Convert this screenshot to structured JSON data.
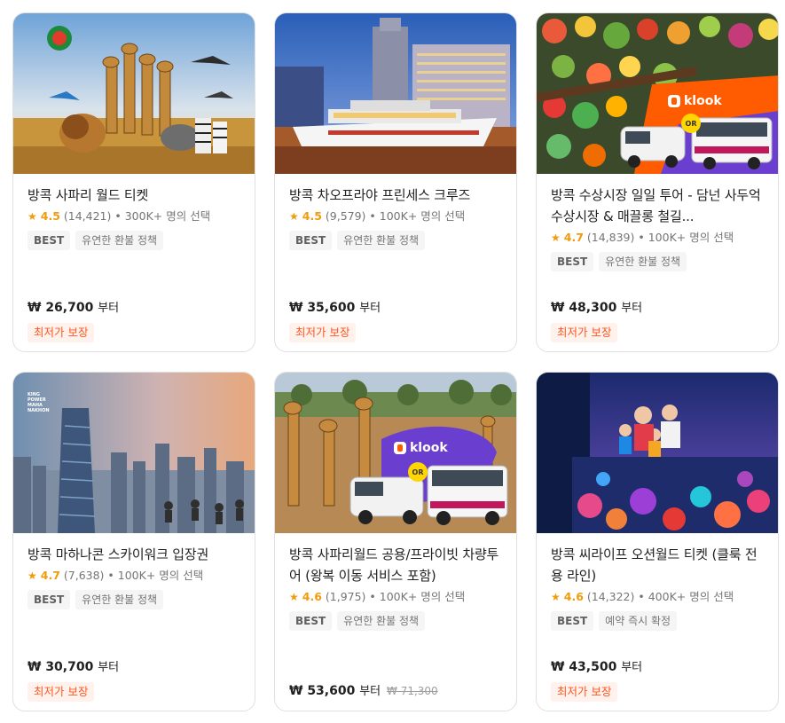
{
  "cards": [
    {
      "title": "방콕 사파리 월드 티켓",
      "score": "4.5",
      "reviews": "(14,421)",
      "booked": "• 300K+ 명의 선택",
      "tag_best": "BEST",
      "tag_refund": "유연한 환불 정책",
      "price": "₩ 26,700",
      "price_suffix": "부터",
      "badge": "최저가 보장"
    },
    {
      "title": "방콕 차오프라야 프린세스 크루즈",
      "score": "4.5",
      "reviews": "(9,579)",
      "booked": "• 100K+ 명의 선택",
      "tag_best": "BEST",
      "tag_refund": "유연한 환불 정책",
      "price": "₩ 35,600",
      "price_suffix": "부터",
      "badge": "최저가 보장"
    },
    {
      "title": "방콕 수상시장 일일 투어 - 담넌 사두억 수상시장 & 매끌롱 철길...",
      "score": "4.7",
      "reviews": "(14,839)",
      "booked": "• 100K+ 명의 선택",
      "tag_best": "BEST",
      "tag_refund": "유연한 환불 정책",
      "price": "₩ 48,300",
      "price_suffix": "부터",
      "badge": "최저가 보장",
      "image_brand": "klook",
      "image_or": "OR"
    },
    {
      "title": "방콕 마하나콘 스카이워크 입장권",
      "score": "4.7",
      "reviews": "(7,638)",
      "booked": "• 100K+ 명의 선택",
      "tag_best": "BEST",
      "tag_refund": "유연한 환불 정책",
      "price": "₩ 30,700",
      "price_suffix": "부터",
      "badge": "최저가 보장",
      "image_logo": "KING POWER MAHA NAKHON"
    },
    {
      "title": "방콕 사파리월드 공용/프라이빗 차량투어 (왕복 이동 서비스 포함)",
      "score": "4.6",
      "reviews": "(1,975)",
      "booked": "• 100K+ 명의 선택",
      "tag_best": "BEST",
      "tag_refund": "유연한 환불 정책",
      "price": "₩ 53,600",
      "price_suffix": "부터",
      "price_original": "₩ 71,300",
      "image_brand": "klook",
      "image_or": "OR"
    },
    {
      "title": "방콕 씨라이프 오션월드 티켓 (클룩 전용 라인)",
      "score": "4.6",
      "reviews": "(14,322)",
      "booked": "• 400K+ 명의 선택",
      "tag_best": "BEST",
      "tag_refund": "예약 즉시 확정",
      "price": "₩ 43,500",
      "price_suffix": "부터",
      "badge": "최저가 보장"
    }
  ],
  "colors": {
    "rating_star": "#f09b0a",
    "badge_text": "#ff5722",
    "badge_bg": "#fff1eb",
    "klook_orange": "#ff5b00"
  },
  "icons": {
    "rating": "star-icon"
  }
}
